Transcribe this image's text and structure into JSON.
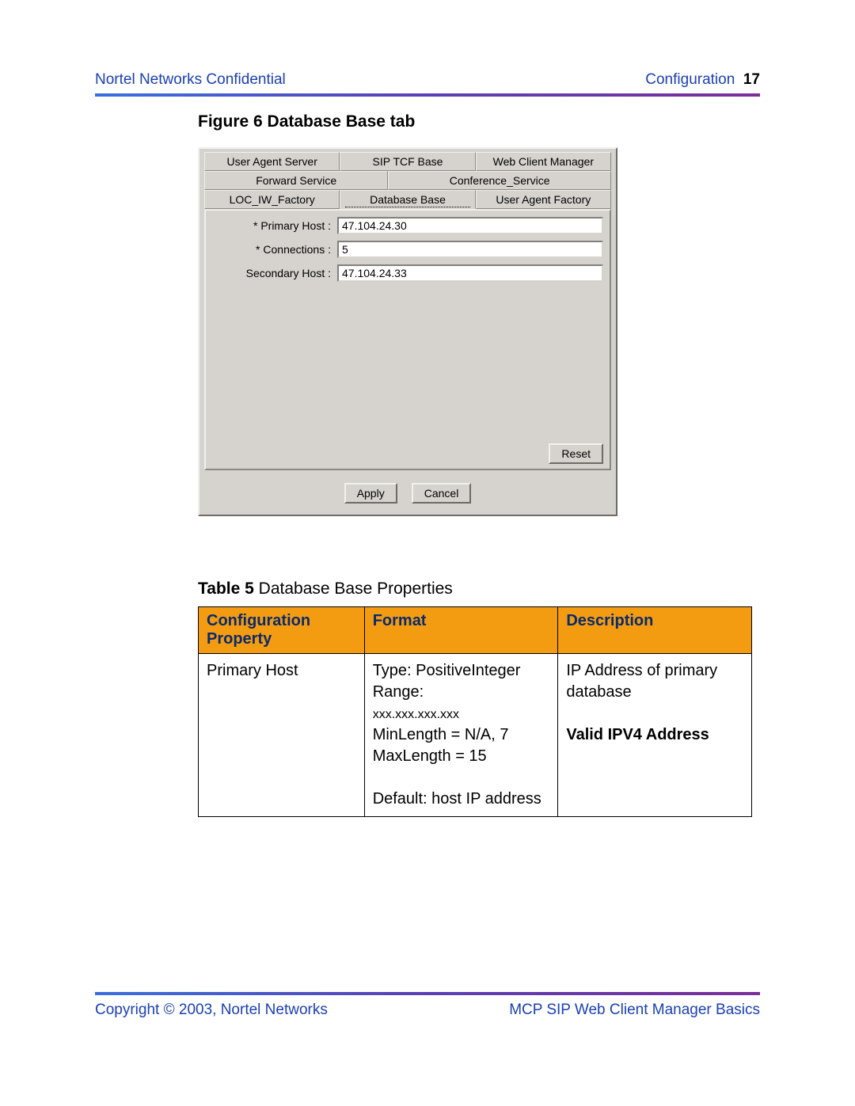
{
  "header": {
    "confidential": "Nortel Networks Confidential",
    "section": "Configuration",
    "page_no": "17"
  },
  "figure": {
    "label": "Figure 6",
    "title": "Database Base tab"
  },
  "dialog": {
    "tabs_row1": [
      "User Agent Server",
      "SIP TCF Base",
      "Web Client Manager"
    ],
    "tabs_row2": [
      "Forward Service",
      "Conference_Service"
    ],
    "tabs_row3": [
      "LOC_IW_Factory",
      "Database Base",
      "User Agent Factory"
    ],
    "active_tab": "Database Base",
    "fields": {
      "primary_host": {
        "label": "* Primary Host :",
        "value": "47.104.24.30"
      },
      "connections": {
        "label": "* Connections :",
        "value": "5"
      },
      "secondary_host": {
        "label": "Secondary Host :",
        "value": "47.104.24.33"
      }
    },
    "buttons": {
      "reset": "Reset",
      "apply": "Apply",
      "cancel": "Cancel"
    }
  },
  "table": {
    "label": "Table 5",
    "title": "Database Base Properties",
    "headers": [
      "Configuration Property",
      "Format",
      "Description"
    ],
    "row": {
      "prop": "Primary Host",
      "format_type": "Type: PositiveInteger",
      "format_range_label": "Range:",
      "format_range_mask": "xxx.xxx.xxx.xxx",
      "format_minmax": "MinLength = N/A, 7 MaxLength = 15",
      "format_default": "Default: host IP address",
      "desc_line1": "IP Address of primary database",
      "desc_bold": "Valid IPV4 Address"
    }
  },
  "footer": {
    "copyright": "Copyright © 2003, Nortel Networks",
    "doc": "MCP SIP Web Client Manager Basics"
  }
}
